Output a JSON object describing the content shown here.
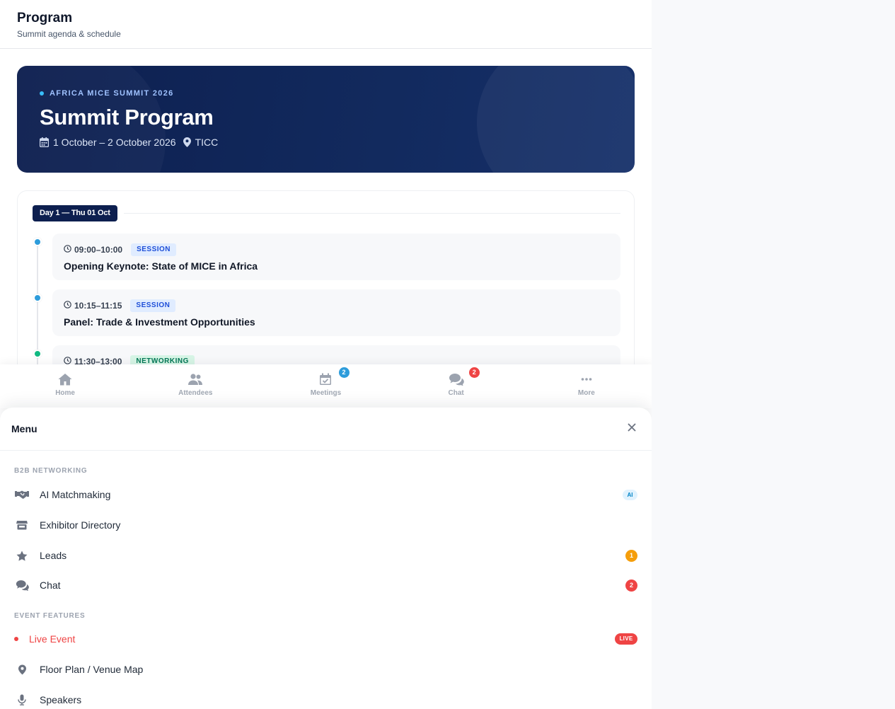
{
  "header": {
    "title": "Program",
    "subtitle": "Summit agenda & schedule"
  },
  "hero": {
    "eyebrow": "AFRICA MICE SUMMIT 2026",
    "title": "Summit Program",
    "dates": "1 October – 2 October 2026",
    "venue": "TICC",
    "calendar_icon": "calendar-icon",
    "location_icon": "map-pin-icon"
  },
  "program": {
    "day_label": "Day 1 — Thu 01 Oct",
    "sessions": [
      {
        "time": "09:00–10:00",
        "type": "SESSION",
        "title": "Opening Keynote: State of MICE in Africa",
        "dot_color": "#2d9cdb"
      },
      {
        "time": "10:15–11:15",
        "type": "SESSION",
        "title": "Panel: Trade & Investment Opportunities",
        "dot_color": "#2d9cdb"
      },
      {
        "time": "11:30–13:00",
        "type": "NETWORKING",
        "title": "",
        "dot_color": "#10b981"
      }
    ]
  },
  "bottom_nav": {
    "items": [
      {
        "label": "Home",
        "icon": "home-icon",
        "badge": ""
      },
      {
        "label": "Attendees",
        "icon": "users-icon",
        "badge": ""
      },
      {
        "label": "Meetings",
        "icon": "calendar-check-icon",
        "badge": "2",
        "badge_color": "#2d9cdb"
      },
      {
        "label": "Chat",
        "icon": "chat-icon",
        "badge": "2",
        "badge_color": "#ef4444"
      },
      {
        "label": "More",
        "icon": "more-icon",
        "badge": ""
      }
    ]
  },
  "menu": {
    "title": "Menu",
    "close_icon": "close-icon",
    "sections": [
      {
        "label": "B2B NETWORKING",
        "items": [
          {
            "label": "AI Matchmaking",
            "icon": "handshake-icon",
            "badge": "AI"
          },
          {
            "label": "Exhibitor Directory",
            "icon": "store-icon",
            "badge": ""
          },
          {
            "label": "Leads",
            "icon": "star-icon",
            "badge": "1",
            "badge_color": "#f59e0b"
          },
          {
            "label": "Chat",
            "icon": "chat-icon",
            "badge": "2",
            "badge_color": "#ef4444"
          }
        ]
      },
      {
        "label": "EVENT FEATURES",
        "items": [
          {
            "label": "Live Event",
            "icon": "live-dot-icon",
            "badge": "LIVE",
            "label_color": "#ef4444"
          },
          {
            "label": "Floor Plan / Venue Map",
            "icon": "map-pin-icon",
            "badge": ""
          },
          {
            "label": "Speakers",
            "icon": "microphone-icon",
            "badge": ""
          }
        ]
      }
    ]
  },
  "colors": {
    "navy": "#0d1f4f",
    "accent_blue": "#2d9cdb",
    "green": "#10b981",
    "red": "#ef4444",
    "amber": "#f59e0b"
  }
}
